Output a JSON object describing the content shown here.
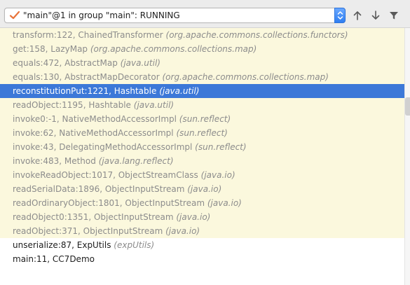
{
  "toolbar": {
    "thread_label": "\"main\"@1 in group \"main\": RUNNING",
    "status_icon": "check-icon",
    "up_icon": "arrow-up-icon",
    "down_icon": "arrow-down-icon",
    "filter_icon": "filter-icon"
  },
  "colors": {
    "library_frame_bg": "#fbf8dd",
    "selected_frame_bg": "#3c78d8",
    "check_mark": "#e8743b"
  },
  "frames": [
    {
      "method": "transform:122, ChainedTransformer",
      "package": "(org.apache.commons.collections.functors)",
      "kind": "library"
    },
    {
      "method": "get:158, LazyMap",
      "package": "(org.apache.commons.collections.map)",
      "kind": "library"
    },
    {
      "method": "equals:472, AbstractMap",
      "package": "(java.util)",
      "kind": "library"
    },
    {
      "method": "equals:130, AbstractMapDecorator",
      "package": "(org.apache.commons.collections.map)",
      "kind": "library"
    },
    {
      "method": "reconstitutionPut:1221, Hashtable",
      "package": "(java.util)",
      "kind": "selected"
    },
    {
      "method": "readObject:1195, Hashtable",
      "package": "(java.util)",
      "kind": "library"
    },
    {
      "method": "invoke0:-1, NativeMethodAccessorImpl",
      "package": "(sun.reflect)",
      "kind": "library"
    },
    {
      "method": "invoke:62, NativeMethodAccessorImpl",
      "package": "(sun.reflect)",
      "kind": "library"
    },
    {
      "method": "invoke:43, DelegatingMethodAccessorImpl",
      "package": "(sun.reflect)",
      "kind": "library"
    },
    {
      "method": "invoke:483, Method",
      "package": "(java.lang.reflect)",
      "kind": "library"
    },
    {
      "method": "invokeReadObject:1017, ObjectStreamClass",
      "package": "(java.io)",
      "kind": "library"
    },
    {
      "method": "readSerialData:1896, ObjectInputStream",
      "package": "(java.io)",
      "kind": "library"
    },
    {
      "method": "readOrdinaryObject:1801, ObjectInputStream",
      "package": "(java.io)",
      "kind": "library"
    },
    {
      "method": "readObject0:1351, ObjectInputStream",
      "package": "(java.io)",
      "kind": "library"
    },
    {
      "method": "readObject:371, ObjectInputStream",
      "package": "(java.io)",
      "kind": "library"
    },
    {
      "method": "unserialize:87, ExpUtils",
      "package": "(expUtils)",
      "kind": "user"
    },
    {
      "method": "main:11, CC7Demo",
      "package": "",
      "kind": "user"
    }
  ]
}
